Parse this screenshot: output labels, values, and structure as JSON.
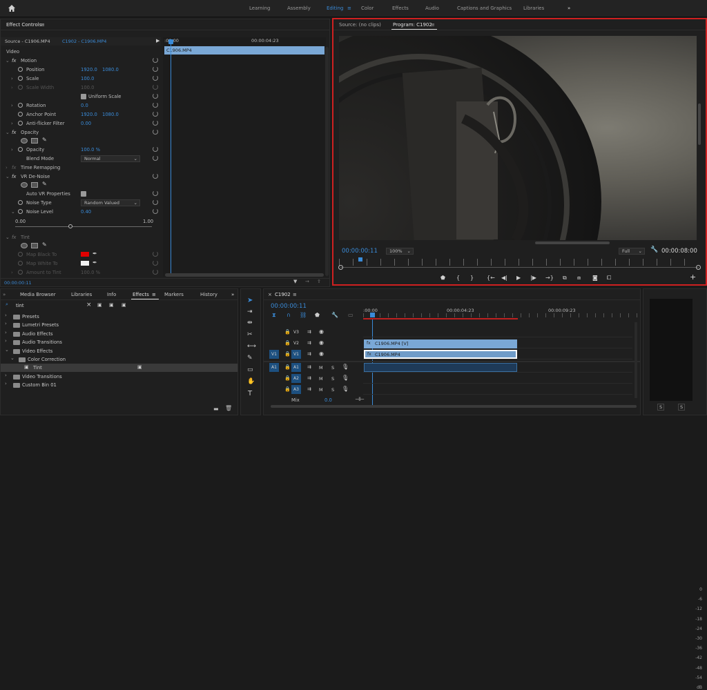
{
  "workspaces": {
    "home": "home-icon",
    "items": [
      "Learning",
      "Assembly",
      "Editing",
      "Color",
      "Effects",
      "Audio",
      "Captions and Graphics",
      "Libraries"
    ],
    "active": "Editing",
    "more": "»"
  },
  "effect_controls": {
    "title": "Effect Controls",
    "menu": "≡",
    "source_tab": "Source - C1906.MP4",
    "clip_tab": "C1902 - C1906.MP4",
    "ruler_start": ":00:00",
    "ruler_end": "00:00:04:23",
    "clip_bar": "C1906.MP4",
    "section_video": "Video",
    "motion": "Motion",
    "position_label": "Position",
    "position_x": "1920.0",
    "position_y": "1080.0",
    "scale_label": "Scale",
    "scale_val": "100.0",
    "scale_width_label": "Scale Width",
    "scale_width_val": "100.0",
    "uniform_scale": "Uniform Scale",
    "rotation_label": "Rotation",
    "rotation_val": "0.0",
    "anchor_label": "Anchor Point",
    "anchor_x": "1920.0",
    "anchor_y": "1080.0",
    "antiflicker_label": "Anti-flicker Filter",
    "antiflicker_val": "0.00",
    "opacity": "Opacity",
    "opacity_label": "Opacity",
    "opacity_val": "100.0 %",
    "blend_label": "Blend Mode",
    "blend_val": "Normal",
    "time_remap": "Time Remapping",
    "vr_denoise": "VR De-Noise",
    "auto_vr": "Auto VR Properties",
    "noise_type_label": "Noise Type",
    "noise_type_val": "Random Valued",
    "noise_level_label": "Noise Level",
    "noise_level_val": "0.40",
    "slider_min": "0.00",
    "slider_max": "1.00",
    "tint": "Tint",
    "map_black": "Map Black To",
    "map_white": "Map White To",
    "amount_label": "Amount to Tint",
    "amount_val": "100.0 %",
    "timecode": "00:00:00:11",
    "colors": {
      "map_black": "#e00000",
      "map_white": "#f0f0f0"
    }
  },
  "program": {
    "source_tab": "Source: (no clips)",
    "program_tab": "Program: C1902",
    "menu": "≡",
    "timecode": "00:00:00:11",
    "zoom": "100%",
    "quality": "Full",
    "duration": "00:00:08:00",
    "wrench": "wrench-icon",
    "add": "+"
  },
  "project": {
    "more_left": "»",
    "tabs": [
      "Media Browser",
      "Libraries",
      "Info",
      "Effects",
      "Markers",
      "History"
    ],
    "active": "Effects",
    "more": "»",
    "menu": "≡",
    "search_value": "tint",
    "clear": "×",
    "tree": [
      {
        "label": "Presets",
        "indent": 0
      },
      {
        "label": "Lumetri Presets",
        "indent": 0
      },
      {
        "label": "Audio Effects",
        "indent": 0
      },
      {
        "label": "Audio Transitions",
        "indent": 0
      },
      {
        "label": "Video Effects",
        "indent": 0
      },
      {
        "label": "Color Correction",
        "indent": 1
      },
      {
        "label": "Tint",
        "indent": 2
      },
      {
        "label": "Video Transitions",
        "indent": 0
      },
      {
        "label": "Custom Bin 01",
        "indent": 0
      }
    ]
  },
  "timeline": {
    "close": "×",
    "title": "C1902",
    "menu": "≡",
    "timecode": "00:00:00:11",
    "ruler": [
      ":00:00",
      "00:00:04:23",
      "00:00:09:23"
    ],
    "tracks": [
      {
        "src": "",
        "name": "V3",
        "lock": true
      },
      {
        "src": "",
        "name": "V2",
        "lock": true
      },
      {
        "src": "V1",
        "name": "V1",
        "lock": true
      },
      {
        "src": "A1",
        "name": "A1",
        "lock": true,
        "m": "M",
        "s": "S"
      },
      {
        "src": "",
        "name": "A2",
        "lock": true,
        "m": "M",
        "s": "S"
      },
      {
        "src": "",
        "name": "A3",
        "lock": true,
        "m": "M",
        "s": "S"
      }
    ],
    "mix_label": "Mix",
    "mix_val": "0.0",
    "clip_v2": "C1906.MP4 [V]",
    "clip_v1": "C1906.MP4"
  },
  "audio_meter": {
    "scale": [
      "0",
      "-6",
      "-12",
      "-18",
      "-24",
      "-30",
      "-36",
      "-42",
      "-48",
      "-54",
      "dB"
    ],
    "solo_left": "S",
    "solo_right": "S"
  }
}
